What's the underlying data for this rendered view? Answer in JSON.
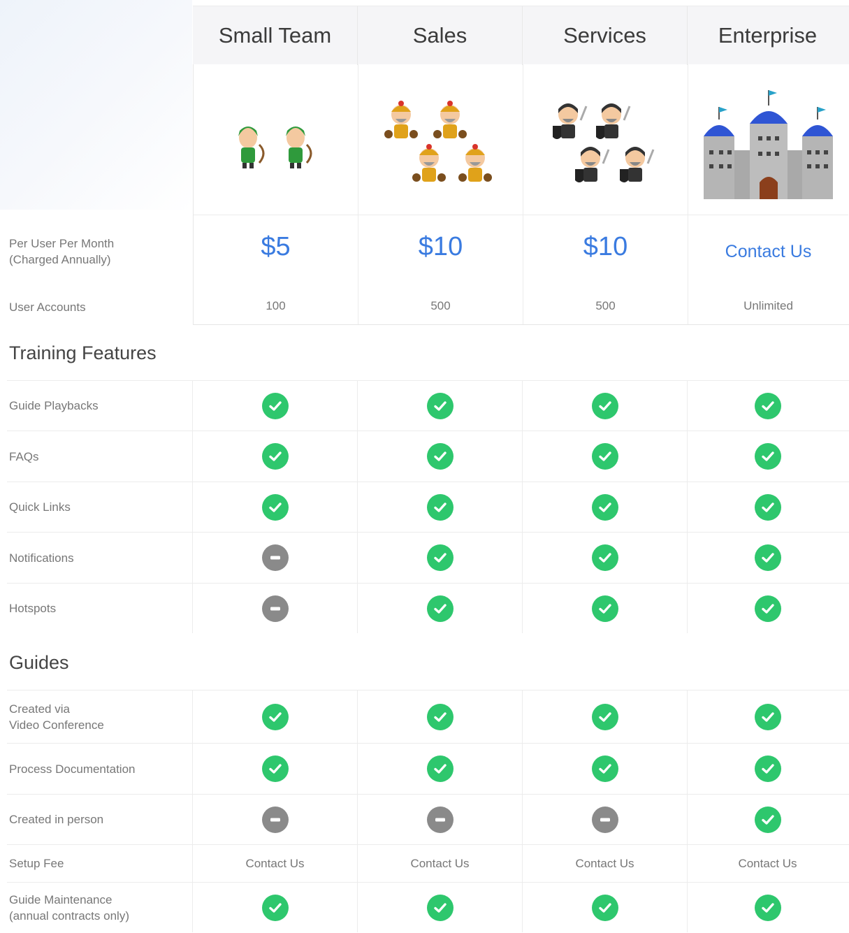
{
  "plans": [
    {
      "name": "Small Team",
      "price": "$5",
      "accounts": "100"
    },
    {
      "name": "Sales",
      "price": "$10",
      "accounts": "500"
    },
    {
      "name": "Services",
      "price": "$10",
      "accounts": "500"
    },
    {
      "name": "Enterprise",
      "price": "Contact Us",
      "accounts": "Unlimited"
    }
  ],
  "labels": {
    "price_line1": "Per User Per Month",
    "price_line2": "(Charged Annually)",
    "accounts": "User Accounts"
  },
  "sections": {
    "training": "Training Features",
    "guides": "Guides"
  },
  "training_rows": [
    {
      "label": "Guide Playbacks",
      "values": [
        "check",
        "check",
        "check",
        "check"
      ]
    },
    {
      "label": "FAQs",
      "values": [
        "check",
        "check",
        "check",
        "check"
      ]
    },
    {
      "label": "Quick Links",
      "values": [
        "check",
        "check",
        "check",
        "check"
      ]
    },
    {
      "label": "Notifications",
      "values": [
        "minus",
        "check",
        "check",
        "check"
      ]
    },
    {
      "label": "Hotspots",
      "values": [
        "minus",
        "check",
        "check",
        "check"
      ]
    }
  ],
  "guide_rows": [
    {
      "label_line1": "Created via",
      "label_line2": "Video Conference",
      "values": [
        "check",
        "check",
        "check",
        "check"
      ]
    },
    {
      "label_line1": "Process Documentation",
      "label_line2": "",
      "values": [
        "check",
        "check",
        "check",
        "check"
      ]
    },
    {
      "label_line1": "Created in person",
      "label_line2": "",
      "values": [
        "minus",
        "minus",
        "minus",
        "check"
      ]
    },
    {
      "label_line1": "Setup Fee",
      "label_line2": "",
      "values": [
        "Contact Us",
        "Contact Us",
        "Contact Us",
        "Contact Us"
      ]
    },
    {
      "label_line1": "Guide Maintenance",
      "label_line2": "(annual contracts only)",
      "values": [
        "check",
        "check",
        "check",
        "check"
      ]
    }
  ],
  "colors": {
    "price": "#3a7be0",
    "check": "#2ec76d",
    "minus": "#8a8a8a"
  },
  "icons": {
    "check": "check-circle-icon",
    "minus": "minus-circle-icon"
  }
}
